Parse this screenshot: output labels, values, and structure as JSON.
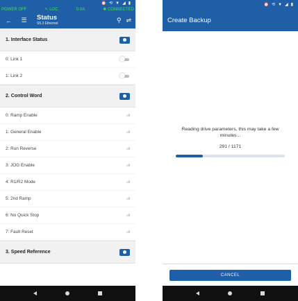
{
  "colors": {
    "primary": "#1e5fa8",
    "connected_green": "#42e64a",
    "navbar": "#101010",
    "section_bg": "#f1f1f1"
  },
  "system_icons": [
    "alarm-icon",
    "sync-icon",
    "signal-icon",
    "wifi-icon",
    "battery-icon"
  ],
  "left": {
    "drive_status": {
      "power": "POWER OFF",
      "mode": "LOC",
      "current": "0.0A",
      "connection": "CONNECTED"
    },
    "appbar": {
      "title": "Status",
      "subtitle": "S5.3 Ethernet"
    },
    "sections": [
      {
        "title": "1. Interface Status",
        "rows": [
          {
            "label": "0: Link 1",
            "type": "toggle"
          },
          {
            "label": "1: Link 2",
            "type": "toggle"
          }
        ]
      },
      {
        "title": "2. Control Word",
        "rows": [
          {
            "label": "0: Ramp Enable",
            "value": "off"
          },
          {
            "label": "1: General Enable",
            "value": "off"
          },
          {
            "label": "2: Run Reverse",
            "value": "off"
          },
          {
            "label": "3: JOG Enable",
            "value": "off"
          },
          {
            "label": "4: R1/R2 Mode",
            "value": "off"
          },
          {
            "label": "5: 2nd Ramp",
            "value": "off"
          },
          {
            "label": "6: No Quick Stop",
            "value": "off"
          },
          {
            "label": "7: Fault Reset",
            "value": "off"
          }
        ]
      },
      {
        "title": "3. Speed Reference",
        "rows": []
      }
    ]
  },
  "right": {
    "appbar": {
      "title": "Create Backup"
    },
    "progress": {
      "message": "Reading drive parameters, this may take a few minutes...",
      "current": 291,
      "total": 1171,
      "count_text": "291 / 1171"
    },
    "cancel_label": "CANCEL"
  }
}
